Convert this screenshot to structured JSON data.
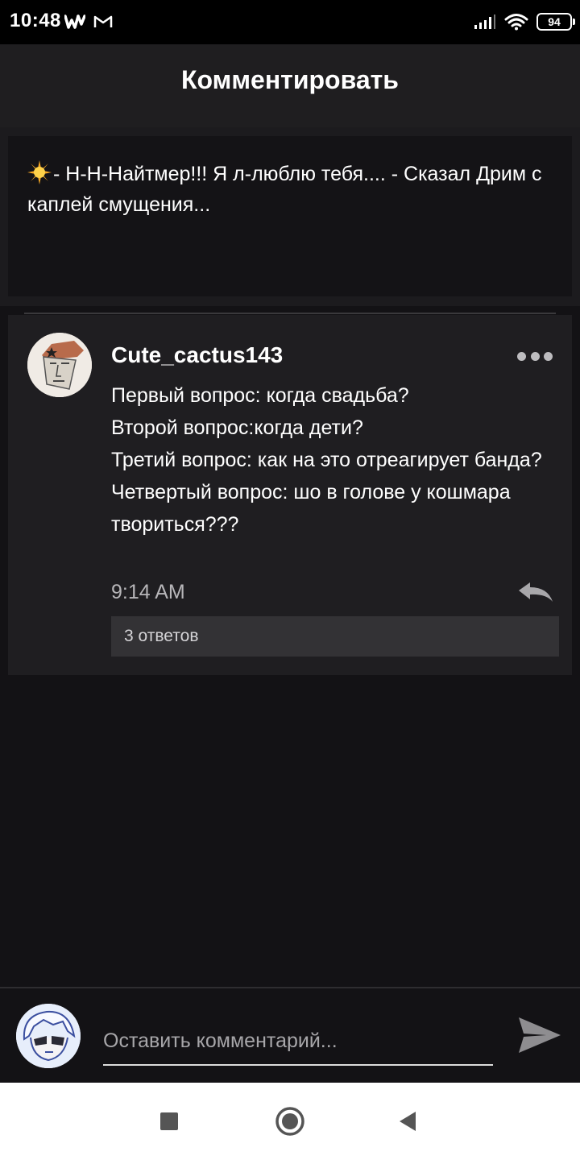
{
  "status_bar": {
    "time": "10:48",
    "battery": "94",
    "app_icons": [
      "wattpad-icon",
      "gmail-icon"
    ],
    "system_icons": [
      "signal-icon",
      "wifi-icon",
      "battery-icon"
    ]
  },
  "header": {
    "title": "Комментировать"
  },
  "quote": {
    "emoji": "sun-emoji-icon",
    "text": "- Н-Н-Найтмер!!! Я л-люблю тебя.... - Сказал Дрим с каплей смущения..."
  },
  "comment": {
    "author": "Cute_cactus143",
    "lines": [
      "Первый вопрос: когда свадьба?",
      "Второй вопрос:когда дети?",
      "Третий вопрос: как на это отреагирует банда?",
      "Четвертый вопрос: шо в голове у кошмара твориться???"
    ],
    "time": "9:14 AM",
    "replies_label": "3 ответов"
  },
  "composer": {
    "placeholder": "Оставить комментарий...",
    "value": ""
  },
  "colors": {
    "background": "#131215",
    "card": "#1f1e21",
    "accent_text": "#ffffff",
    "muted_text": "#b7b6b9"
  }
}
